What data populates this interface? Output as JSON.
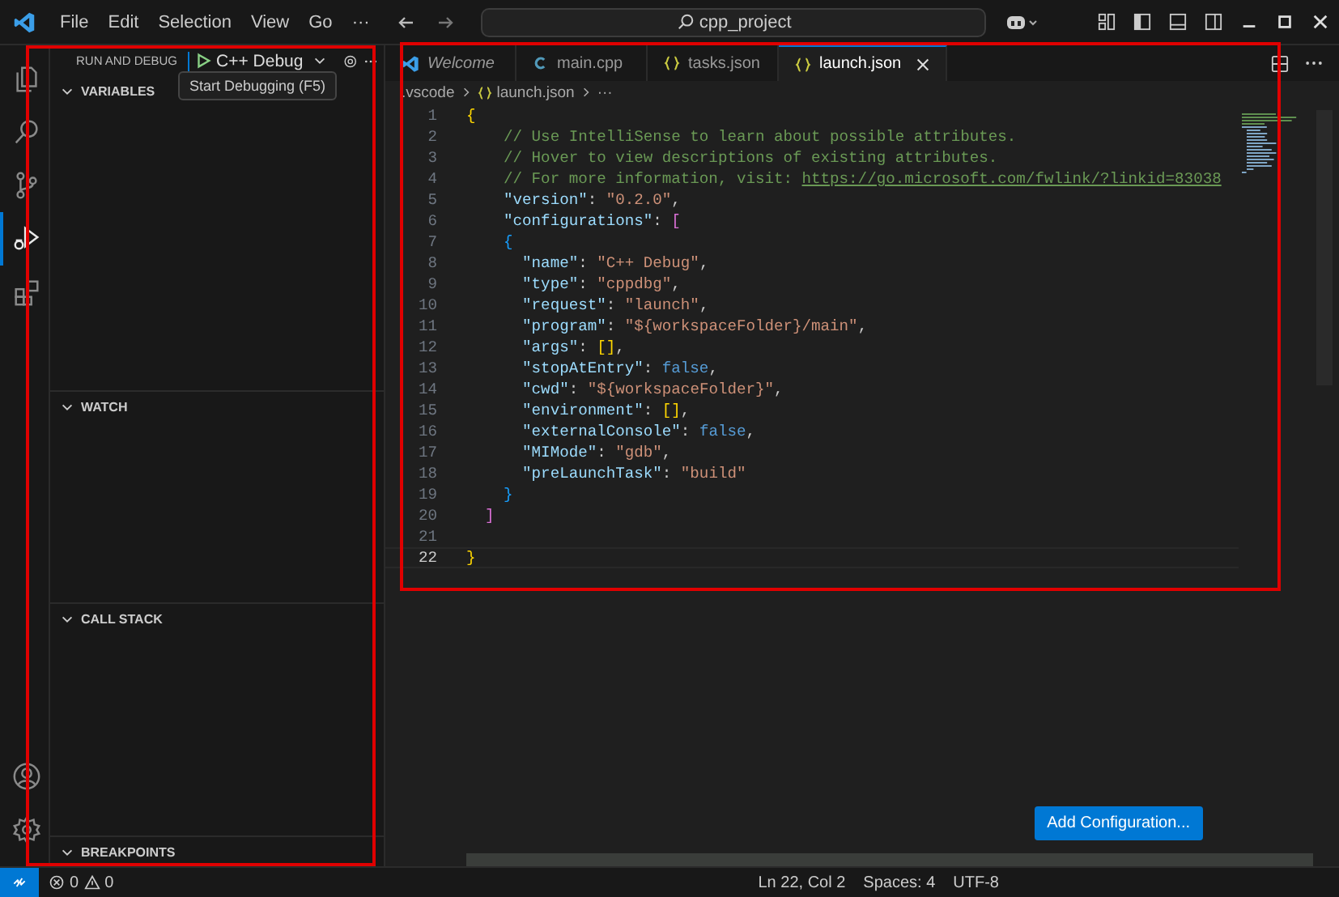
{
  "title_bar": {
    "menu": [
      "File",
      "Edit",
      "Selection",
      "View",
      "Go",
      "···"
    ],
    "search": "cpp_project"
  },
  "activity_bar": {
    "top": [
      {
        "kind": "files",
        "selected": false
      },
      {
        "kind": "search",
        "selected": false
      },
      {
        "kind": "branch",
        "selected": false
      },
      {
        "kind": "debug",
        "selected": true
      },
      {
        "kind": "extensions",
        "selected": false
      }
    ],
    "bottom": [
      {
        "kind": "account",
        "selected": false
      },
      {
        "kind": "settings",
        "selected": false
      }
    ]
  },
  "sidebar": {
    "title": "RUN AND DEBUG",
    "configuration": "C++ Debug",
    "tooltip": "Start Debugging (F5)",
    "highlighted": true,
    "sections": [
      {
        "label": "VARIABLES",
        "expanded": true
      },
      {
        "label": "WATCH",
        "expanded": true
      },
      {
        "label": "CALL STACK",
        "expanded": true
      },
      {
        "label": "BREAKPOINTS",
        "expanded": true
      }
    ]
  },
  "tabs": [
    {
      "label": "Welcome",
      "kind": "vscode",
      "preview": true,
      "selected": false
    },
    {
      "label": "main.cpp",
      "kind": "cpp",
      "preview": false,
      "selected": false
    },
    {
      "label": "tasks.json",
      "kind": "json",
      "preview": false,
      "selected": false
    },
    {
      "label": "launch.json",
      "kind": "json",
      "preview": false,
      "selected": true
    }
  ],
  "breadcrumb": [
    {
      "label": ".vscode",
      "kind": "folder"
    },
    {
      "label": "launch.json",
      "kind": "json"
    },
    {
      "label": "···",
      "kind": "more"
    }
  ],
  "editor": {
    "highlighted": true,
    "lines": [
      {
        "number": "1",
        "tokens": [
          {
            "t": "{",
            "kind": "brace"
          }
        ]
      },
      {
        "number": "2",
        "tokens": [
          {
            "t": "    // Use IntelliSense to learn about possible attributes.",
            "kind": "comment"
          }
        ]
      },
      {
        "number": "3",
        "tokens": [
          {
            "t": "    // Hover to view descriptions of existing attributes.",
            "kind": "comment"
          }
        ]
      },
      {
        "number": "4",
        "tokens": [
          {
            "t": "    // For more information, visit: ",
            "kind": "comment"
          },
          {
            "t": "https://go.microsoft.com/fwlink/?linkid=83038",
            "kind": "link"
          }
        ]
      },
      {
        "number": "5",
        "tokens": [
          {
            "t": "    \"version\"",
            "kind": "key"
          },
          {
            "t": ": ",
            "kind": "punctuation"
          },
          {
            "t": "\"0.2.0\"",
            "kind": "string"
          },
          {
            "t": ",",
            "kind": "punctuation"
          }
        ]
      },
      {
        "number": "6",
        "tokens": [
          {
            "t": "    \"configurations\"",
            "kind": "key"
          },
          {
            "t": ": ",
            "kind": "punctuation"
          },
          {
            "t": "[",
            "kind": "bracket"
          }
        ]
      },
      {
        "number": "7",
        "tokens": [
          {
            "t": "    {",
            "kind": "object"
          }
        ]
      },
      {
        "number": "8",
        "tokens": [
          {
            "t": "      \"name\"",
            "kind": "key"
          },
          {
            "t": ": ",
            "kind": "punctuation"
          },
          {
            "t": "\"C++ Debug\"",
            "kind": "string"
          },
          {
            "t": ",",
            "kind": "punctuation"
          }
        ]
      },
      {
        "number": "9",
        "tokens": [
          {
            "t": "      \"type\"",
            "kind": "key"
          },
          {
            "t": ": ",
            "kind": "punctuation"
          },
          {
            "t": "\"cppdbg\"",
            "kind": "string"
          },
          {
            "t": ",",
            "kind": "punctuation"
          }
        ]
      },
      {
        "number": "10",
        "tokens": [
          {
            "t": "      \"request\"",
            "kind": "key"
          },
          {
            "t": ": ",
            "kind": "punctuation"
          },
          {
            "t": "\"launch\"",
            "kind": "string"
          },
          {
            "t": ",",
            "kind": "punctuation"
          }
        ]
      },
      {
        "number": "11",
        "tokens": [
          {
            "t": "      \"program\"",
            "kind": "key"
          },
          {
            "t": ": ",
            "kind": "punctuation"
          },
          {
            "t": "\"${workspaceFolder}/main\"",
            "kind": "string"
          },
          {
            "t": ",",
            "kind": "punctuation"
          }
        ]
      },
      {
        "number": "12",
        "tokens": [
          {
            "t": "      \"args\"",
            "kind": "key"
          },
          {
            "t": ": ",
            "kind": "punctuation"
          },
          {
            "t": "[]",
            "kind": "brace"
          },
          {
            "t": ",",
            "kind": "punctuation"
          }
        ]
      },
      {
        "number": "13",
        "tokens": [
          {
            "t": "      \"stopAtEntry\"",
            "kind": "key"
          },
          {
            "t": ": ",
            "kind": "punctuation"
          },
          {
            "t": "false",
            "kind": "boolean"
          },
          {
            "t": ",",
            "kind": "punctuation"
          }
        ]
      },
      {
        "number": "14",
        "tokens": [
          {
            "t": "      \"cwd\"",
            "kind": "key"
          },
          {
            "t": ": ",
            "kind": "punctuation"
          },
          {
            "t": "\"${workspaceFolder}\"",
            "kind": "string"
          },
          {
            "t": ",",
            "kind": "punctuation"
          }
        ]
      },
      {
        "number": "15",
        "tokens": [
          {
            "t": "      \"environment\"",
            "kind": "key"
          },
          {
            "t": ": ",
            "kind": "punctuation"
          },
          {
            "t": "[]",
            "kind": "brace"
          },
          {
            "t": ",",
            "kind": "punctuation"
          }
        ]
      },
      {
        "number": "16",
        "tokens": [
          {
            "t": "      \"externalConsole\"",
            "kind": "key"
          },
          {
            "t": ": ",
            "kind": "punctuation"
          },
          {
            "t": "false",
            "kind": "boolean"
          },
          {
            "t": ",",
            "kind": "punctuation"
          }
        ]
      },
      {
        "number": "17",
        "tokens": [
          {
            "t": "      \"MIMode\"",
            "kind": "key"
          },
          {
            "t": ": ",
            "kind": "punctuation"
          },
          {
            "t": "\"gdb\"",
            "kind": "string"
          },
          {
            "t": ",",
            "kind": "punctuation"
          }
        ]
      },
      {
        "number": "18",
        "tokens": [
          {
            "t": "      \"preLaunchTask\"",
            "kind": "key"
          },
          {
            "t": ": ",
            "kind": "punctuation"
          },
          {
            "t": "\"build\"",
            "kind": "string"
          }
        ]
      },
      {
        "number": "19",
        "tokens": [
          {
            "t": "    }",
            "kind": "object"
          }
        ]
      },
      {
        "number": "20",
        "tokens": [
          {
            "t": "  ]",
            "kind": "bracket"
          }
        ]
      },
      {
        "number": "21"
      },
      {
        "number": "22",
        "current": true,
        "tokens": [
          {
            "t": "}",
            "kind": "brace"
          }
        ]
      }
    ]
  },
  "add_configuration": "Add Configuration...",
  "status_bar": {
    "errors": "0",
    "warnings": "0",
    "items": [
      "Ln 22, Col 2",
      "Spaces: 4",
      "UTF-8"
    ]
  }
}
